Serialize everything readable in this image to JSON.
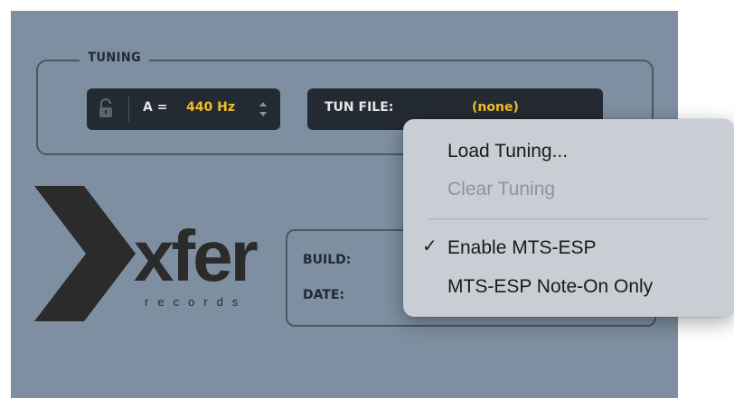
{
  "tuning": {
    "group_label": "TUNING",
    "pitch_label": "A =",
    "pitch_value": "440 Hz",
    "tun_file_label": "TUN FILE:",
    "tun_file_value": "(none)"
  },
  "logo": {
    "wordmark": "xfer",
    "subtitle": "records"
  },
  "info": {
    "build_label": "BUILD:",
    "date_label": "DATE:"
  },
  "context_menu": {
    "items": [
      {
        "label": "Load Tuning...",
        "enabled": true,
        "checked": false
      },
      {
        "label": "Clear Tuning",
        "enabled": false,
        "checked": false
      },
      {
        "label": "Enable MTS-ESP",
        "enabled": true,
        "checked": true
      },
      {
        "label": "MTS-ESP Note-On Only",
        "enabled": true,
        "checked": false
      }
    ],
    "check_glyph": "✓"
  },
  "colors": {
    "panel_bg": "#7d8fa0",
    "field_bg": "#242a31",
    "accent_value": "#f0bd2a",
    "menu_bg": "#c9ced4"
  }
}
